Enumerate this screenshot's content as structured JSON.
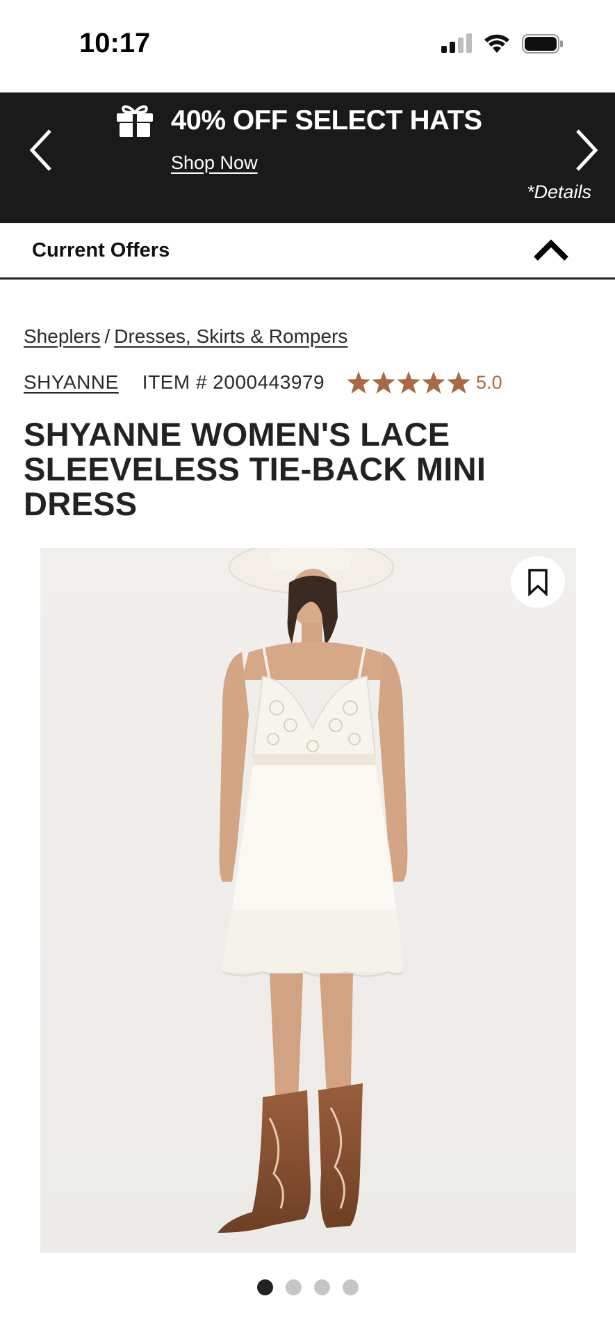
{
  "status_bar": {
    "time": "10:17"
  },
  "promo": {
    "title": "40% OFF SELECT HATS",
    "link": "Shop Now",
    "details": "*Details",
    "icon": "gift-icon"
  },
  "offers": {
    "label": "Current Offers",
    "state": "expanded"
  },
  "breadcrumb": {
    "home": "Sheplers",
    "separator": "/",
    "category": "Dresses, Skirts & Rompers"
  },
  "product": {
    "brand": "SHYANNE",
    "item_number": "ITEM # 2000443979",
    "rating": "5.0",
    "stars": 5,
    "title": "SHYANNE WOMEN'S LACE SLEEVELESS TIE-BACK MINI DRESS"
  },
  "carousel": {
    "count": 4,
    "active": 0
  },
  "colors": {
    "banner_bg": "#1a1a1a",
    "star": "#a86a45",
    "text": "#222222"
  }
}
